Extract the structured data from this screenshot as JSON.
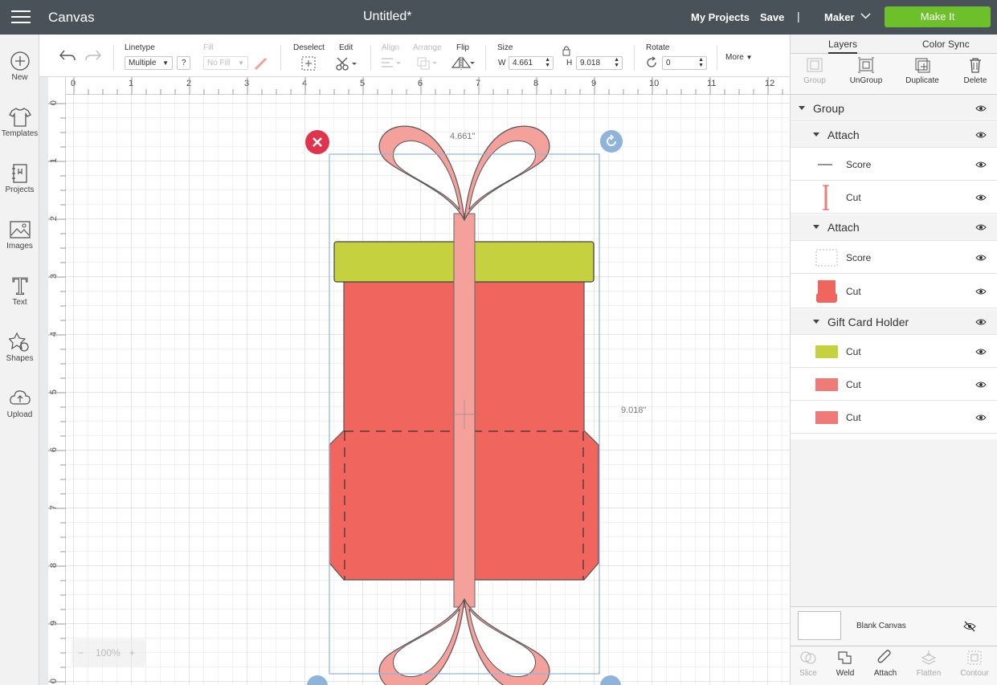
{
  "topbar": {
    "app_title": "Canvas",
    "doc_title": "Untitled*",
    "my_projects": "My Projects",
    "save": "Save",
    "separator": "|",
    "machine": "Maker",
    "make_it": "Make It",
    "make_it_color": "#6ec02b",
    "bar_color": "#495259"
  },
  "sidebar": {
    "items": [
      {
        "label": "New",
        "icon": "plus-circle-icon"
      },
      {
        "label": "Templates",
        "icon": "tshirt-icon"
      },
      {
        "label": "Projects",
        "icon": "notebook-icon"
      },
      {
        "label": "Images",
        "icon": "picture-icon"
      },
      {
        "label": "Text",
        "icon": "text-t-icon"
      },
      {
        "label": "Shapes",
        "icon": "shapes-icon"
      },
      {
        "label": "Upload",
        "icon": "cloud-upload-icon"
      }
    ]
  },
  "toolbar": {
    "linetype_label": "Linetype",
    "linetype_value": "Multiple",
    "help": "?",
    "fill_label": "Fill",
    "fill_value": "No Fill",
    "deselect": "Deselect",
    "edit": "Edit",
    "align": "Align",
    "arrange": "Arrange",
    "flip": "Flip",
    "size_label": "Size",
    "w_label": "W",
    "w_value": "4.661",
    "h_label": "H",
    "h_value": "9.018",
    "rotate_label": "Rotate",
    "rotate_value": "0",
    "more": "More"
  },
  "rulers": {
    "top": [
      "0",
      "1",
      "2",
      "3",
      "4",
      "5",
      "6",
      "7",
      "8",
      "9",
      "10",
      "11",
      "12"
    ],
    "left": [
      "0",
      "1",
      "2",
      "3",
      "4",
      "5",
      "6",
      "7",
      "8",
      "9",
      "0"
    ]
  },
  "selection": {
    "width_label": "4.661\"",
    "height_label": "9.018\""
  },
  "zoom": {
    "minus": "−",
    "value": "100%",
    "plus": "+"
  },
  "right_panel": {
    "tabs": [
      "Layers",
      "Color Sync"
    ],
    "actions": [
      {
        "label": "Group",
        "enabled": false,
        "icon": "group-icon"
      },
      {
        "label": "UnGroup",
        "enabled": true,
        "icon": "ungroup-icon"
      },
      {
        "label": "Duplicate",
        "enabled": true,
        "icon": "duplicate-icon"
      },
      {
        "label": "Delete",
        "enabled": true,
        "icon": "trash-icon"
      }
    ],
    "layers": [
      {
        "name": "Group",
        "kind": "group"
      },
      {
        "name": "Attach",
        "kind": "subgroup"
      },
      {
        "name": "Score",
        "kind": "item",
        "swatch": "score-line"
      },
      {
        "name": "Cut",
        "kind": "item",
        "swatch": "ribbon-strip"
      },
      {
        "name": "Attach",
        "kind": "subgroup"
      },
      {
        "name": "Score",
        "kind": "item",
        "swatch": "score-box"
      },
      {
        "name": "Cut",
        "kind": "item",
        "swatch": "box-shape"
      },
      {
        "name": "Gift Card Holder",
        "kind": "subgroup"
      },
      {
        "name": "Cut",
        "kind": "item",
        "swatch": "lid"
      },
      {
        "name": "Cut",
        "kind": "item",
        "swatch": "pink-rect"
      },
      {
        "name": "Cut",
        "kind": "item",
        "swatch": "pink-rect"
      }
    ],
    "blank_canvas": "Blank Canvas",
    "bottom_actions": [
      {
        "label": "Slice",
        "enabled": false,
        "icon": "slice-icon"
      },
      {
        "label": "Weld",
        "enabled": true,
        "icon": "weld-icon"
      },
      {
        "label": "Attach",
        "enabled": true,
        "icon": "paperclip-icon"
      },
      {
        "label": "Flatten",
        "enabled": false,
        "icon": "flatten-icon"
      },
      {
        "label": "Contour",
        "enabled": false,
        "icon": "contour-icon"
      }
    ]
  },
  "colors": {
    "box": "#f0655d",
    "lid": "#c5d13e",
    "ribbon": "#f4a19c",
    "selection": "#8fb3d9",
    "delete_handle": "#e0344e",
    "rotate_handle": "#8fb3d9"
  }
}
